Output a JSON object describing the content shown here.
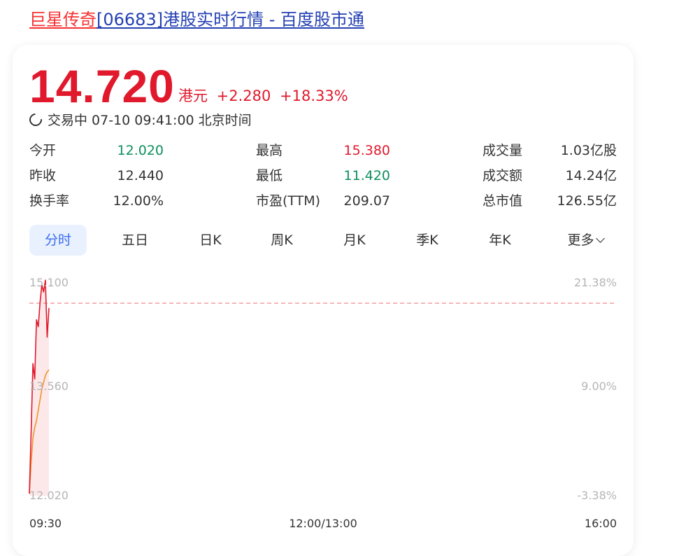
{
  "title": {
    "highlight": "巨星传奇",
    "rest": "[06683]港股实时行情 - 百度股市通"
  },
  "quote": {
    "price": "14.720",
    "currency": "港元",
    "change": "+2.280",
    "change_pct": "+18.33%",
    "status": "交易中 07-10 09:41:00 北京时间"
  },
  "stats": {
    "open_label": "今开",
    "open": "12.020",
    "high_label": "最高",
    "high": "15.380",
    "volume_label": "成交量",
    "volume": "1.03亿股",
    "prev_close_label": "昨收",
    "prev_close": "12.440",
    "low_label": "最低",
    "low": "11.420",
    "turnover_label": "成交额",
    "turnover": "14.24亿",
    "turnover_rate_label": "换手率",
    "turnover_rate": "12.00%",
    "pe_label": "市盈(TTM)",
    "pe": "209.07",
    "market_cap_label": "总市值",
    "market_cap": "126.55亿"
  },
  "tabs": [
    "分时",
    "五日",
    "日K",
    "周K",
    "月K",
    "季K",
    "年K",
    "更多"
  ],
  "active_tab": "分时",
  "colors": {
    "up": "#e0192c",
    "down": "#0e8f5d",
    "avg_line": "#f0932b",
    "active_tab_bg": "#e9f1ff",
    "active_tab_text": "#3a6df0",
    "title_highlight": "#f73131",
    "title_link": "#2440b3"
  },
  "chart_data": {
    "type": "line",
    "title": "",
    "xlabel": "",
    "ylabel": "",
    "y_left_ticks": [
      "15.100",
      "13.560",
      "12.020"
    ],
    "y_right_ticks": [
      "21.38%",
      "9.00%",
      "-3.38%"
    ],
    "x_ticks": [
      "09:30",
      "12:00/13:00",
      "16:00"
    ],
    "ylim": [
      12.02,
      15.1
    ],
    "prev_close": 12.44,
    "x_minutes": [
      0,
      1,
      2,
      3,
      4,
      5,
      6,
      7,
      8,
      9,
      10,
      11
    ],
    "series": [
      {
        "values": [
          12.05,
          12.95,
          13.92,
          13.7,
          14.55,
          14.45,
          14.8,
          15.05,
          14.95,
          15.12,
          14.3,
          14.72
        ]
      },
      {
        "values": [
          12.05,
          12.5,
          12.85,
          13.0,
          13.1,
          13.25,
          13.4,
          13.55,
          13.65,
          13.75,
          13.8,
          13.83
        ]
      }
    ]
  }
}
